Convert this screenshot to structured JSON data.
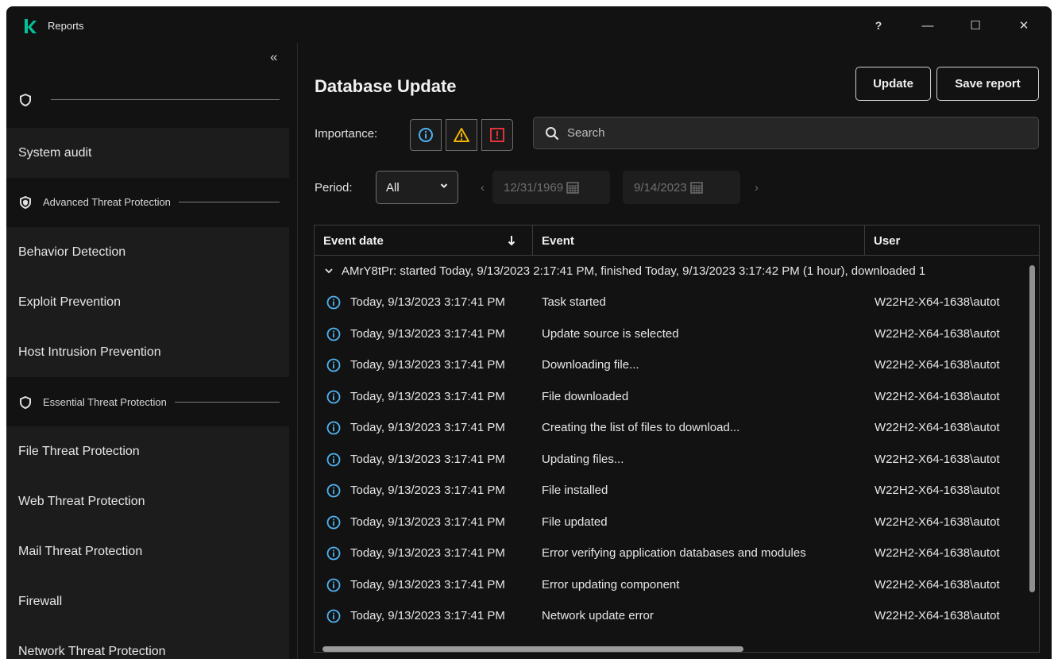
{
  "window": {
    "title": "Reports"
  },
  "titlebar": {
    "help": "?",
    "minimize": "—",
    "maximize": "☐",
    "close": "✕"
  },
  "sidebar": {
    "collapse": "«",
    "items": [
      {
        "type": "group",
        "label": "",
        "icon": "shield-icon"
      },
      {
        "type": "item",
        "label": "System audit"
      },
      {
        "type": "group",
        "label": "Advanced Threat Protection",
        "icon": "shield-advanced-icon"
      },
      {
        "type": "item",
        "label": "Behavior Detection"
      },
      {
        "type": "item",
        "label": "Exploit Prevention"
      },
      {
        "type": "item",
        "label": "Host Intrusion Prevention"
      },
      {
        "type": "group",
        "label": "Essential Threat Protection",
        "icon": "shield-icon"
      },
      {
        "type": "item",
        "label": "File Threat Protection"
      },
      {
        "type": "item",
        "label": "Web Threat Protection"
      },
      {
        "type": "item",
        "label": "Mail Threat Protection"
      },
      {
        "type": "item",
        "label": "Firewall"
      },
      {
        "type": "item",
        "label": "Network Threat Protection"
      }
    ]
  },
  "main": {
    "title": "Database Update",
    "update_label": "Update",
    "save_report_label": "Save report",
    "importance_label": "Importance:",
    "search_placeholder": "Search",
    "period_label": "Period:",
    "period_value": "All",
    "date_from": "12/31/1969",
    "date_to": "9/14/2023"
  },
  "table": {
    "columns": [
      "Event date",
      "Event",
      "User"
    ],
    "group_label": "AMrY8tPr: started Today, 9/13/2023 2:17:41 PM, finished Today, 9/13/2023 3:17:42 PM (1 hour), downloaded 1",
    "rows": [
      {
        "date": "Today, 9/13/2023 3:17:41 PM",
        "event": "Task started",
        "user": "W22H2-X64-1638\\autot"
      },
      {
        "date": "Today, 9/13/2023 3:17:41 PM",
        "event": "Update source is selected",
        "user": "W22H2-X64-1638\\autot"
      },
      {
        "date": "Today, 9/13/2023 3:17:41 PM",
        "event": "Downloading file...",
        "user": "W22H2-X64-1638\\autot"
      },
      {
        "date": "Today, 9/13/2023 3:17:41 PM",
        "event": "File downloaded",
        "user": "W22H2-X64-1638\\autot"
      },
      {
        "date": "Today, 9/13/2023 3:17:41 PM",
        "event": "Creating the list of files to download...",
        "user": "W22H2-X64-1638\\autot"
      },
      {
        "date": "Today, 9/13/2023 3:17:41 PM",
        "event": "Updating files...",
        "user": "W22H2-X64-1638\\autot"
      },
      {
        "date": "Today, 9/13/2023 3:17:41 PM",
        "event": "File installed",
        "user": "W22H2-X64-1638\\autot"
      },
      {
        "date": "Today, 9/13/2023 3:17:41 PM",
        "event": "File updated",
        "user": "W22H2-X64-1638\\autot"
      },
      {
        "date": "Today, 9/13/2023 3:17:41 PM",
        "event": "Error verifying application databases and modules",
        "user": "W22H2-X64-1638\\autot"
      },
      {
        "date": "Today, 9/13/2023 3:17:41 PM",
        "event": "Error updating component",
        "user": "W22H2-X64-1638\\autot"
      },
      {
        "date": "Today, 9/13/2023 3:17:41 PM",
        "event": "Network update error",
        "user": "W22H2-X64-1638\\autot"
      }
    ]
  },
  "colors": {
    "background": "#121212",
    "accent_info": "#4fb3f2",
    "accent_warning": "#f0b400",
    "accent_error": "#e0343c",
    "brand": "#00c49a"
  }
}
